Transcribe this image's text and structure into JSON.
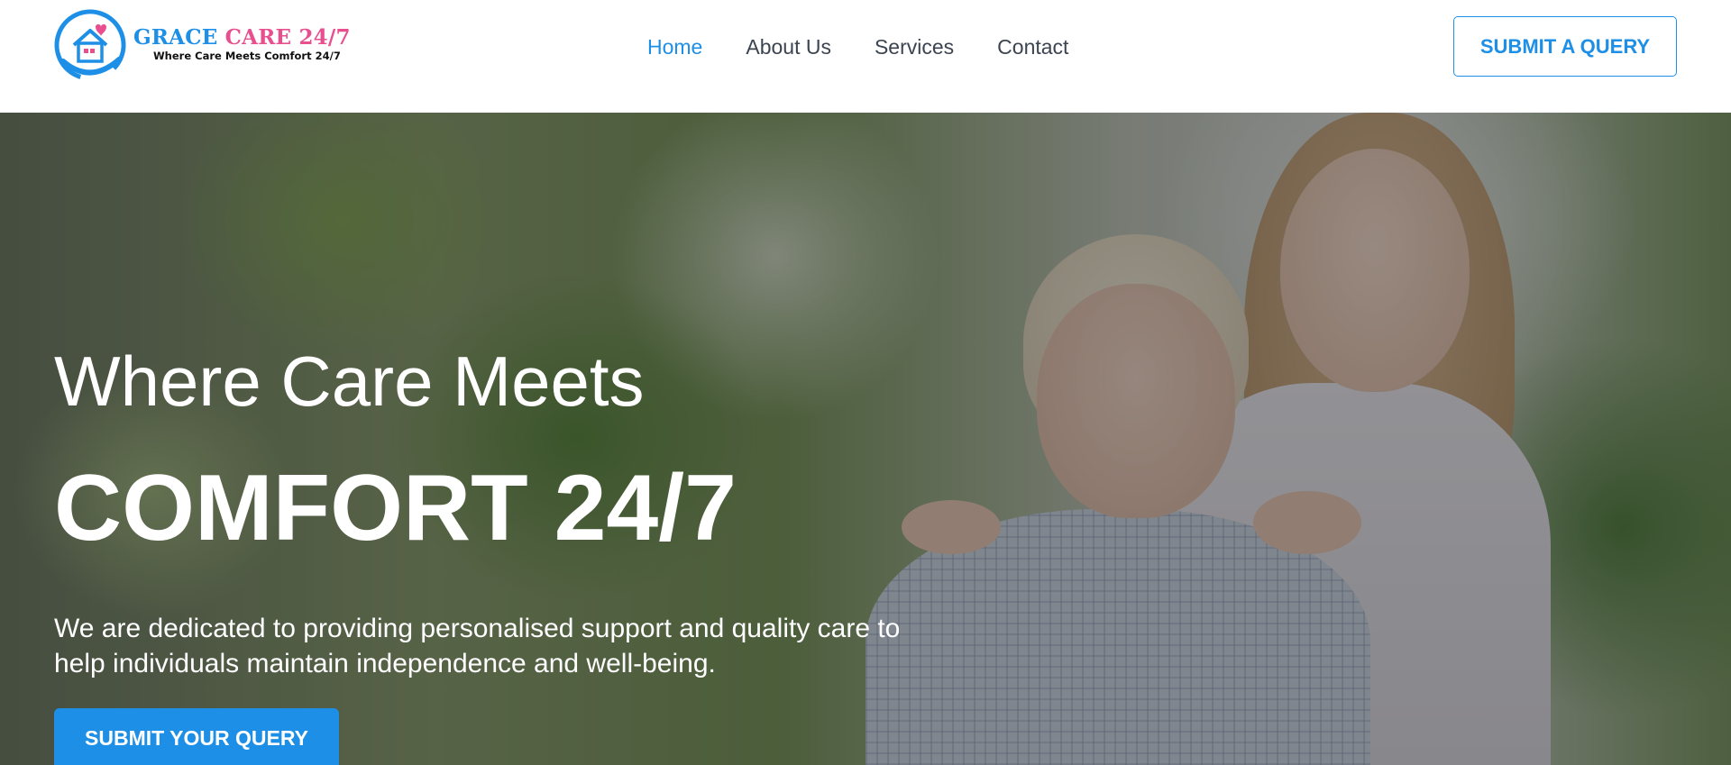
{
  "header": {
    "logo": {
      "name_part1": "GRACE",
      "name_part2": "CARE 24/7",
      "tagline": "Where Care Meets Comfort 24/7"
    },
    "nav": [
      {
        "label": "Home",
        "active": true
      },
      {
        "label": "About Us",
        "active": false
      },
      {
        "label": "Services",
        "active": false
      },
      {
        "label": "Contact",
        "active": false
      }
    ],
    "cta_label": "SUBMIT A QUERY"
  },
  "hero": {
    "title_line1": "Where Care Meets",
    "title_line2": "COMFORT 24/7",
    "description": "We are dedicated to providing personalised support and quality care to help individuals maintain independence and well-being.",
    "button_label": "SUBMIT YOUR QUERY"
  },
  "colors": {
    "accent": "#1e8fe6",
    "brand_pink": "#e84f8f",
    "nav_text": "#3b4450"
  }
}
